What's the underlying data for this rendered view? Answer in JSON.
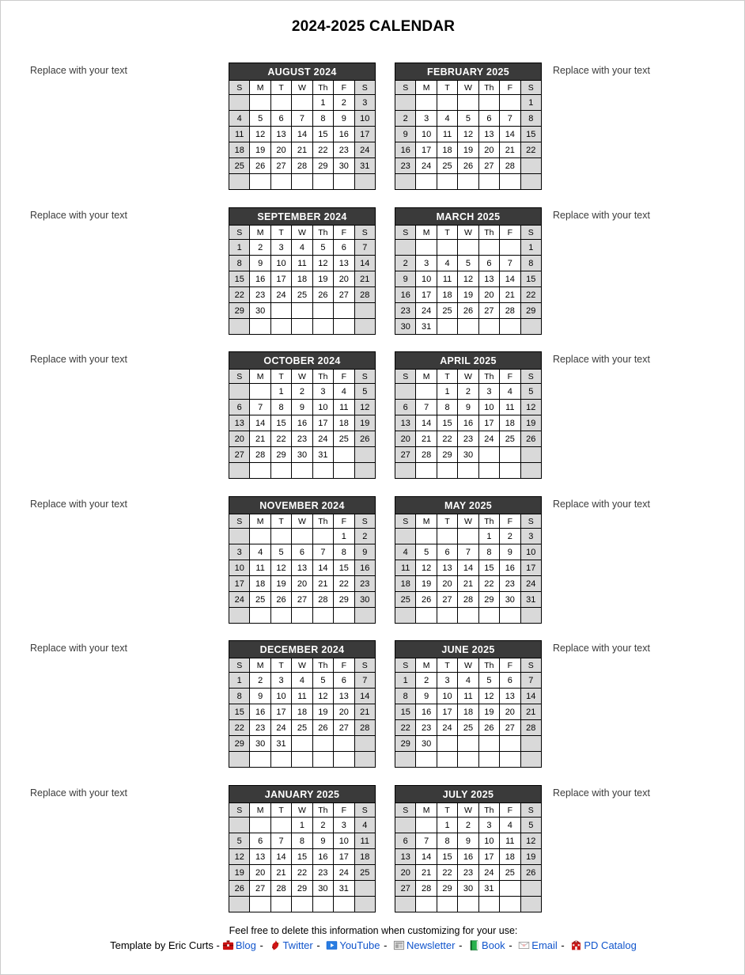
{
  "title": "2024-2025 CALENDAR",
  "note_text": "Replace with your text",
  "dow": [
    "S",
    "M",
    "T",
    "W",
    "Th",
    "F",
    "S"
  ],
  "colors": {
    "month_header_bg": "#3a3a3a",
    "month_header_fg": "#ffffff",
    "weekend_bg": "#d9d9d9",
    "weekday_bg": "#ffffff",
    "grid_line": "#000000",
    "link": "#1155cc"
  },
  "rows": [
    {
      "left": "august_2024",
      "right": "february_2025"
    },
    {
      "left": "september_2024",
      "right": "march_2025"
    },
    {
      "left": "october_2024",
      "right": "april_2025"
    },
    {
      "left": "november_2024",
      "right": "may_2025"
    },
    {
      "left": "december_2024",
      "right": "june_2025"
    },
    {
      "left": "january_2025",
      "right": "july_2025"
    }
  ],
  "months": {
    "august_2024": {
      "label": "AUGUST 2024",
      "weeks": [
        [
          "",
          "",
          "",
          "",
          "1",
          "2",
          "3"
        ],
        [
          "4",
          "5",
          "6",
          "7",
          "8",
          "9",
          "10"
        ],
        [
          "11",
          "12",
          "13",
          "14",
          "15",
          "16",
          "17"
        ],
        [
          "18",
          "19",
          "20",
          "21",
          "22",
          "23",
          "24"
        ],
        [
          "25",
          "26",
          "27",
          "28",
          "29",
          "30",
          "31"
        ],
        [
          "",
          "",
          "",
          "",
          "",
          "",
          ""
        ]
      ]
    },
    "september_2024": {
      "label": "SEPTEMBER 2024",
      "weeks": [
        [
          "1",
          "2",
          "3",
          "4",
          "5",
          "6",
          "7"
        ],
        [
          "8",
          "9",
          "10",
          "11",
          "12",
          "13",
          "14"
        ],
        [
          "15",
          "16",
          "17",
          "18",
          "19",
          "20",
          "21"
        ],
        [
          "22",
          "23",
          "24",
          "25",
          "26",
          "27",
          "28"
        ],
        [
          "29",
          "30",
          "",
          "",
          "",
          "",
          ""
        ],
        [
          "",
          "",
          "",
          "",
          "",
          "",
          ""
        ]
      ]
    },
    "october_2024": {
      "label": "OCTOBER 2024",
      "weeks": [
        [
          "",
          "",
          "1",
          "2",
          "3",
          "4",
          "5"
        ],
        [
          "6",
          "7",
          "8",
          "9",
          "10",
          "11",
          "12"
        ],
        [
          "13",
          "14",
          "15",
          "16",
          "17",
          "18",
          "19"
        ],
        [
          "20",
          "21",
          "22",
          "23",
          "24",
          "25",
          "26"
        ],
        [
          "27",
          "28",
          "29",
          "30",
          "31",
          "",
          ""
        ],
        [
          "",
          "",
          "",
          "",
          "",
          "",
          ""
        ]
      ]
    },
    "november_2024": {
      "label": "NOVEMBER 2024",
      "weeks": [
        [
          "",
          "",
          "",
          "",
          "",
          "1",
          "2"
        ],
        [
          "3",
          "4",
          "5",
          "6",
          "7",
          "8",
          "9"
        ],
        [
          "10",
          "11",
          "12",
          "13",
          "14",
          "15",
          "16"
        ],
        [
          "17",
          "18",
          "19",
          "20",
          "21",
          "22",
          "23"
        ],
        [
          "24",
          "25",
          "26",
          "27",
          "28",
          "29",
          "30"
        ],
        [
          "",
          "",
          "",
          "",
          "",
          "",
          ""
        ]
      ]
    },
    "december_2024": {
      "label": "DECEMBER 2024",
      "weeks": [
        [
          "1",
          "2",
          "3",
          "4",
          "5",
          "6",
          "7"
        ],
        [
          "8",
          "9",
          "10",
          "11",
          "12",
          "13",
          "14"
        ],
        [
          "15",
          "16",
          "17",
          "18",
          "19",
          "20",
          "21"
        ],
        [
          "22",
          "23",
          "24",
          "25",
          "26",
          "27",
          "28"
        ],
        [
          "29",
          "30",
          "31",
          "",
          "",
          "",
          ""
        ],
        [
          "",
          "",
          "",
          "",
          "",
          "",
          ""
        ]
      ]
    },
    "january_2025": {
      "label": "JANUARY 2025",
      "weeks": [
        [
          "",
          "",
          "",
          "1",
          "2",
          "3",
          "4"
        ],
        [
          "5",
          "6",
          "7",
          "8",
          "9",
          "10",
          "11"
        ],
        [
          "12",
          "13",
          "14",
          "15",
          "16",
          "17",
          "18"
        ],
        [
          "19",
          "20",
          "21",
          "22",
          "23",
          "24",
          "25"
        ],
        [
          "26",
          "27",
          "28",
          "29",
          "30",
          "31",
          ""
        ],
        [
          "",
          "",
          "",
          "",
          "",
          "",
          ""
        ]
      ]
    },
    "february_2025": {
      "label": "FEBRUARY 2025",
      "weeks": [
        [
          "",
          "",
          "",
          "",
          "",
          "",
          "1"
        ],
        [
          "2",
          "3",
          "4",
          "5",
          "6",
          "7",
          "8"
        ],
        [
          "9",
          "10",
          "11",
          "12",
          "13",
          "14",
          "15"
        ],
        [
          "16",
          "17",
          "18",
          "19",
          "20",
          "21",
          "22"
        ],
        [
          "23",
          "24",
          "25",
          "26",
          "27",
          "28",
          ""
        ],
        [
          "",
          "",
          "",
          "",
          "",
          "",
          ""
        ]
      ]
    },
    "march_2025": {
      "label": "MARCH 2025",
      "weeks": [
        [
          "",
          "",
          "",
          "",
          "",
          "",
          "1"
        ],
        [
          "2",
          "3",
          "4",
          "5",
          "6",
          "7",
          "8"
        ],
        [
          "9",
          "10",
          "11",
          "12",
          "13",
          "14",
          "15"
        ],
        [
          "16",
          "17",
          "18",
          "19",
          "20",
          "21",
          "22"
        ],
        [
          "23",
          "24",
          "25",
          "26",
          "27",
          "28",
          "29"
        ],
        [
          "30",
          "31",
          "",
          "",
          "",
          "",
          ""
        ]
      ]
    },
    "april_2025": {
      "label": "APRIL 2025",
      "weeks": [
        [
          "",
          "",
          "1",
          "2",
          "3",
          "4",
          "5"
        ],
        [
          "6",
          "7",
          "8",
          "9",
          "10",
          "11",
          "12"
        ],
        [
          "13",
          "14",
          "15",
          "16",
          "17",
          "18",
          "19"
        ],
        [
          "20",
          "21",
          "22",
          "23",
          "24",
          "25",
          "26"
        ],
        [
          "27",
          "28",
          "29",
          "30",
          "",
          "",
          ""
        ],
        [
          "",
          "",
          "",
          "",
          "",
          "",
          ""
        ]
      ]
    },
    "may_2025": {
      "label": "MAY 2025",
      "weeks": [
        [
          "",
          "",
          "",
          "",
          "1",
          "2",
          "3"
        ],
        [
          "4",
          "5",
          "6",
          "7",
          "8",
          "9",
          "10"
        ],
        [
          "11",
          "12",
          "13",
          "14",
          "15",
          "16",
          "17"
        ],
        [
          "18",
          "19",
          "20",
          "21",
          "22",
          "23",
          "24"
        ],
        [
          "25",
          "26",
          "27",
          "28",
          "29",
          "30",
          "31"
        ],
        [
          "",
          "",
          "",
          "",
          "",
          "",
          ""
        ]
      ]
    },
    "june_2025": {
      "label": "JUNE 2025",
      "weeks": [
        [
          "1",
          "2",
          "3",
          "4",
          "5",
          "6",
          "7"
        ],
        [
          "8",
          "9",
          "10",
          "11",
          "12",
          "13",
          "14"
        ],
        [
          "15",
          "16",
          "17",
          "18",
          "19",
          "20",
          "21"
        ],
        [
          "22",
          "23",
          "24",
          "25",
          "26",
          "27",
          "28"
        ],
        [
          "29",
          "30",
          "",
          "",
          "",
          "",
          ""
        ],
        [
          "",
          "",
          "",
          "",
          "",
          "",
          ""
        ]
      ]
    },
    "july_2025": {
      "label": "JULY 2025",
      "weeks": [
        [
          "",
          "",
          "1",
          "2",
          "3",
          "4",
          "5"
        ],
        [
          "6",
          "7",
          "8",
          "9",
          "10",
          "11",
          "12"
        ],
        [
          "13",
          "14",
          "15",
          "16",
          "17",
          "18",
          "19"
        ],
        [
          "20",
          "21",
          "22",
          "23",
          "24",
          "25",
          "26"
        ],
        [
          "27",
          "28",
          "29",
          "30",
          "31",
          "",
          ""
        ],
        [
          "",
          "",
          "",
          "",
          "",
          "",
          ""
        ]
      ]
    }
  },
  "footer": {
    "note": "Feel free to delete this information when customizing for your use:",
    "lead": "Template by Eric Curts -",
    "separator": "-",
    "links": [
      {
        "label": "Blog",
        "icon": "briefcase-icon"
      },
      {
        "label": "Twitter",
        "icon": "cardinal-bird-icon"
      },
      {
        "label": "YouTube",
        "icon": "play-button-icon"
      },
      {
        "label": "Newsletter",
        "icon": "newspaper-icon"
      },
      {
        "label": "Book",
        "icon": "book-icon"
      },
      {
        "label": "Email",
        "icon": "envelope-icon"
      },
      {
        "label": "PD Catalog",
        "icon": "schoolhouse-icon"
      }
    ]
  }
}
